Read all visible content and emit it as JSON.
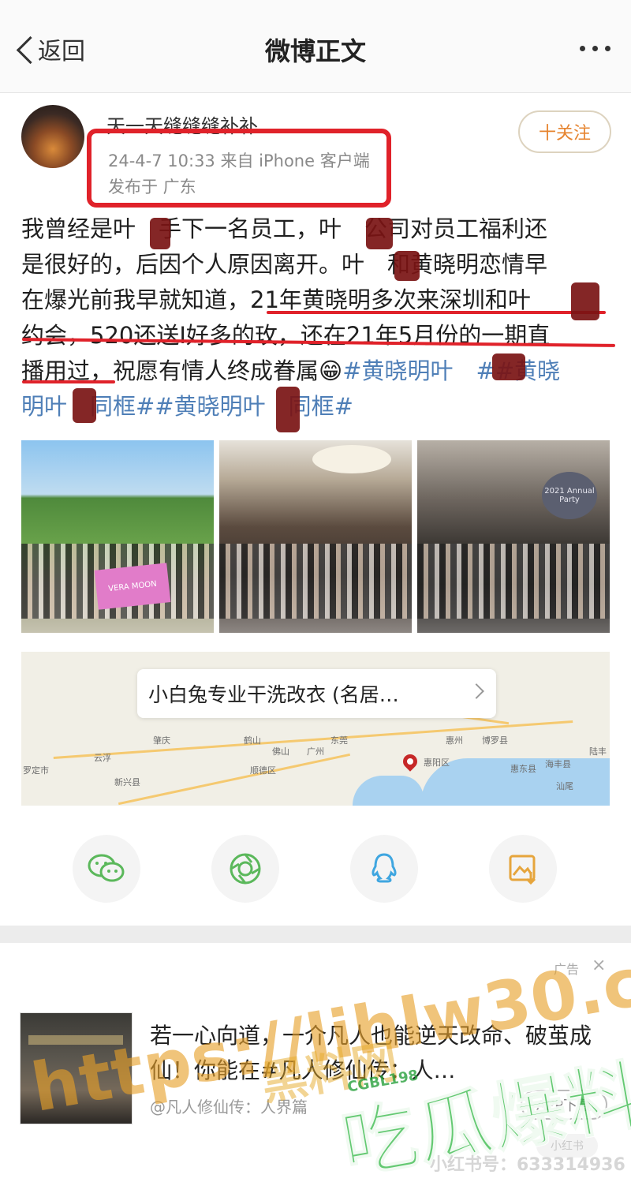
{
  "nav": {
    "back_label": "返回",
    "title": "微博正文"
  },
  "post": {
    "username": "天一天缝缝缝补补",
    "time_source": "24-4-7 10:33  来自 iPhone 客户端",
    "location": "发布于 广东",
    "follow_label": "十关注",
    "text_lines": [
      "我曾经是叶　手下一名员工，叶　公司对员工福利还",
      "是很好的，后因个人原因离开。叶　和黄晓明恋情早",
      "在爆光前我早就知道，21年黄晓明多次来深圳和叶",
      "约会，520还送I好多的玫，还在21年5月份的一期直",
      "播用过，祝愿有情人终成眷属😁"
    ],
    "hashtags_line4": "#黄晓明叶　##黄晓",
    "hashtags_line5": "明叶　同框##黄晓明叶　同框#",
    "photo_banner_text": "VERA MOON",
    "photo_party_text": "2021 Annual Party"
  },
  "map": {
    "location_name": "小白兔专业干洗改衣 (名居…",
    "places": [
      "肇庆",
      "云浮",
      "罗定市",
      "新兴县",
      "鹤山",
      "佛山",
      "东莞",
      "惠州",
      "惠阳区",
      "汕尾",
      "博罗县",
      "海丰县",
      "惠东县",
      "顺德区",
      "广州",
      "陆丰"
    ]
  },
  "share": {
    "icons": [
      "wechat-icon",
      "moments-icon",
      "qq-icon",
      "save-image-icon"
    ]
  },
  "ad": {
    "label": "广告",
    "close": "×",
    "text": "若一心向道，一介凡人也能逆天改命、破茧成仙！你能在#凡人修仙传：人…",
    "source": "@凡人修仙传：人界篇",
    "button": "APP下载",
    "small_label": "小红书"
  },
  "watermarks": {
    "url": "https://lihlw30.com",
    "black": "黑料网",
    "eat": "吃瓜爆料",
    "small": "CGBL198",
    "id": "小红书号：633314936"
  },
  "colors": {
    "accent_red": "#e0222a",
    "tag_blue": "#4f7fb7",
    "follow_orange": "#e6842f"
  }
}
